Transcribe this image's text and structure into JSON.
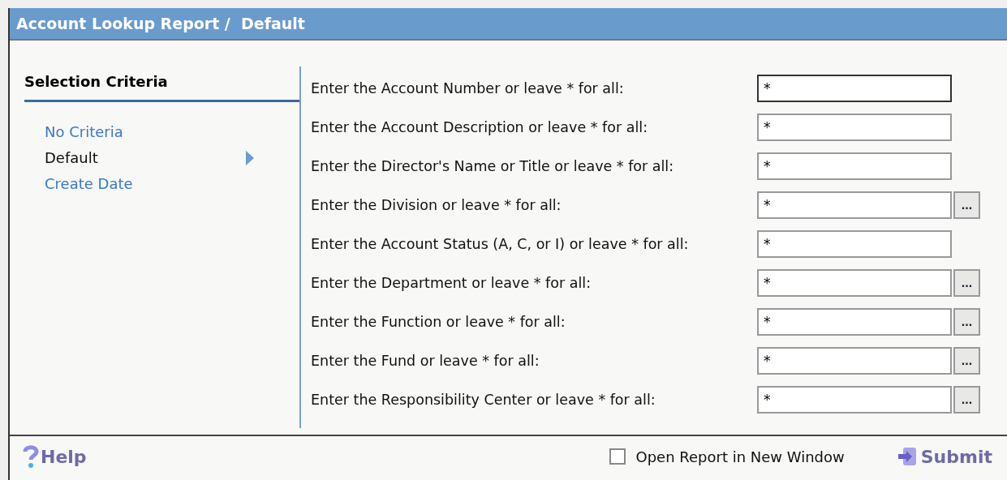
{
  "header": {
    "title": "Account Lookup Report /  Default"
  },
  "sidebar": {
    "heading": "Selection Criteria",
    "items": [
      {
        "label": "No Criteria",
        "selected": false
      },
      {
        "label": "Default",
        "selected": true
      },
      {
        "label": "Create Date",
        "selected": false
      }
    ]
  },
  "fields": [
    {
      "label": "Enter the Account Number or leave * for all:",
      "value": "*",
      "focused": true
    },
    {
      "label": "Enter the Account Description or leave * for all:",
      "value": "*",
      "focused": false
    },
    {
      "label": "Enter the Director's Name or Title or leave * for all:",
      "value": "*",
      "focused": false
    },
    {
      "label": "Enter the Division or leave * for all:",
      "value": "*",
      "focused": false,
      "browse": "..."
    },
    {
      "label": "Enter the Account Status (A, C, or I) or leave * for all:",
      "value": "*",
      "focused": false
    },
    {
      "label": "Enter the Department or leave * for all:",
      "value": "*",
      "focused": false,
      "browse": "..."
    },
    {
      "label": "Enter the Function or leave * for all:",
      "value": "*",
      "focused": false,
      "browse": "..."
    },
    {
      "label": "Enter the Fund or leave * for all:",
      "value": "*",
      "focused": false,
      "browse": "..."
    },
    {
      "label": "Enter the Responsibility Center or leave * for all:",
      "value": "*",
      "focused": false,
      "browse": "..."
    }
  ],
  "footer": {
    "help": "Help",
    "new_window": {
      "label": "Open Report in New Window",
      "checked": false
    },
    "submit": "Submit"
  }
}
